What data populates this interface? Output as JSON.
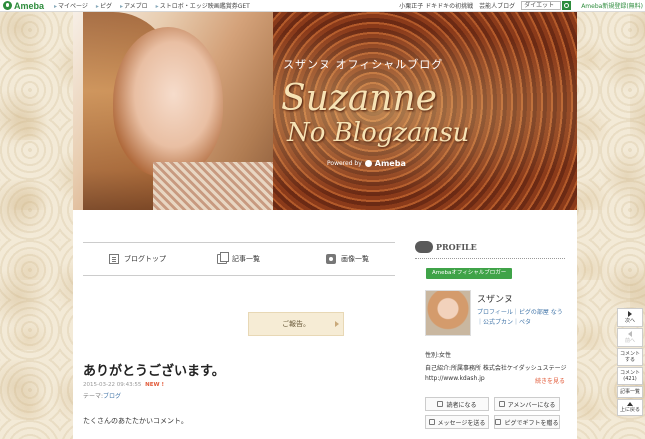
{
  "topbar": {
    "logo": "Ameba",
    "nav": [
      "マイページ",
      "ピグ",
      "アメブロ",
      "ストロボ・エッジ映画鑑賞券GET"
    ],
    "notice": "小栗正子 ドキドキの初挑戦",
    "favorite": "芸能人ブログ",
    "search_value": "ダイエット",
    "signup": "Ameba新規登録(無料)"
  },
  "header": {
    "subtitle": "スザンヌ オフィシャルブログ",
    "title_line1": "Suzanne",
    "title_line2": "No Blogzansu",
    "powered_by": "Powered by",
    "powered_brand": "Ameba"
  },
  "tabs": {
    "top": "ブログトップ",
    "list": "記事一覧",
    "images": "画像一覧"
  },
  "report_button": "ご報告。",
  "entry": {
    "title": "ありがとうございます。",
    "date": "2015-03-22 09:43:55",
    "new_badge": "NEW !",
    "theme_label": "テーマ:",
    "theme": "ブログ",
    "body": "たくさんのあたたかいコメント。"
  },
  "sidebar": {
    "profile_label": "PROFILE",
    "official_badge": "Amebaオフィシャルブロガー",
    "name": "スザンヌ",
    "links": "プロフィール｜ピグの部屋 なう｜公式プカン｜ペタ",
    "gender": "性別:女性",
    "intro": "自己紹介:所属事務所 株式会社ケイダッシュステージ http://www.kdash.jp",
    "more": "続きを見る",
    "buttons": {
      "reader": "読者になる",
      "member": "アメンバーになる",
      "message": "メッセージを送る",
      "gift": "ピグでギフトを贈る"
    }
  },
  "side_nav": {
    "next": "次へ",
    "prev": "前へ",
    "comment": "コメントする",
    "comments_count": "コメント(421)",
    "article_list": "記事一覧",
    "to_top": "上に戻る"
  }
}
